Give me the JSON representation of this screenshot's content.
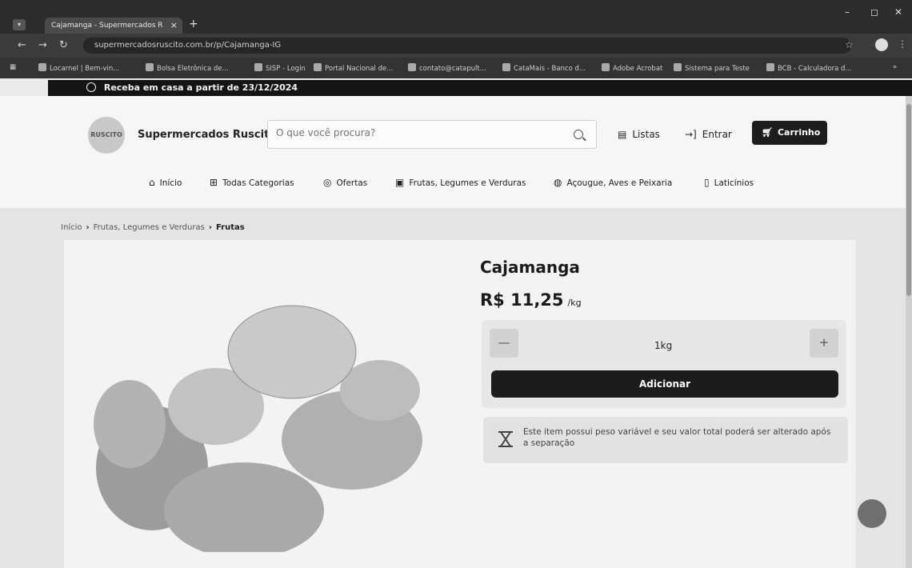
{
  "browser": {
    "tab_title": "Cajamanga - Supermercados R",
    "url": "supermercadosruscito.com.br/p/Cajamanga-IG",
    "bookmarks": [
      "Locarnel | Bem-vin...",
      "Bolsa Eletrônica de...",
      "SISP - Login",
      "Portal Nacional de...",
      "contato@catapult...",
      "CataMais - Banco d...",
      "Adobe Acrobat",
      "Sistema para Teste",
      "BCB - Calculadora d..."
    ]
  },
  "promo": "Receba em casa a partir de 23/12/2024",
  "header": {
    "logo_text": "RUSCITO",
    "brand": "Supermercados Ruscito",
    "search_placeholder": "O que você procura?",
    "lists": "Listas",
    "login": "Entrar",
    "cart": "Carrinho"
  },
  "nav": [
    "Início",
    "Todas Categorias",
    "Ofertas",
    "Frutas, Legumes e Verduras",
    "Açougue, Aves e Peixaria",
    "Laticínios"
  ],
  "breadcrumb": [
    "Início",
    "Frutas, Legumes e Verduras",
    "Frutas"
  ],
  "product": {
    "name": "Cajamanga",
    "price": "R$ 11,25",
    "unit": "/kg",
    "quantity": "1kg",
    "minus": "—",
    "plus": "+",
    "add_label": "Adicionar",
    "notice": "Este item possui peso variável e seu valor total poderá ser alterado após a separação"
  }
}
